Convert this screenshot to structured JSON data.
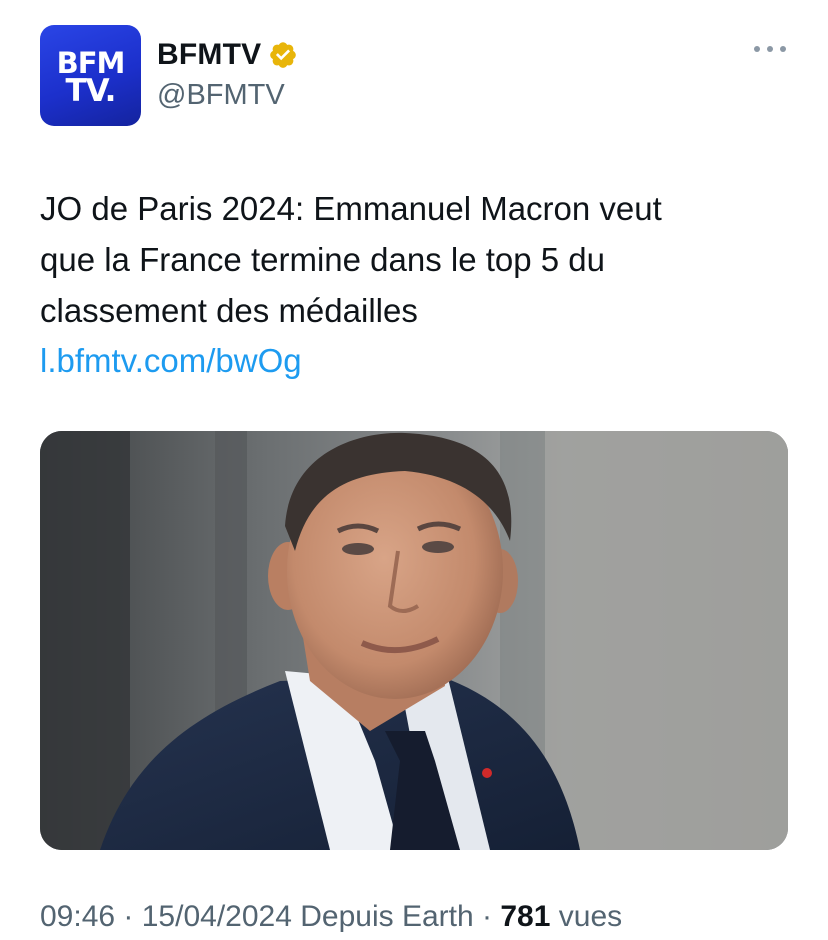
{
  "author": {
    "avatar_text_line1": "BFM",
    "avatar_text_line2": "TV.",
    "display_name": "BFMTV",
    "handle": "@BFMTV",
    "verified_color": "#e8b50a"
  },
  "tweet": {
    "text_lines": [
      "JO de Paris 2024: Emmanuel Macron veut",
      "que la France termine dans le top 5 du",
      "classement des médailles"
    ],
    "link": "l.bfmtv.com/bwOg"
  },
  "meta": {
    "time": "09:46",
    "separator": " · ",
    "date": "15/04/2024",
    "source": "Depuis Earth",
    "views_count": "781",
    "views_label": "vues"
  },
  "icons": {
    "more": "more-horizontal-icon",
    "verified": "verified-badge-icon"
  },
  "colors": {
    "link": "#1d9bf0",
    "secondary_text": "#536471",
    "avatar_blue": "#1c30cc"
  }
}
